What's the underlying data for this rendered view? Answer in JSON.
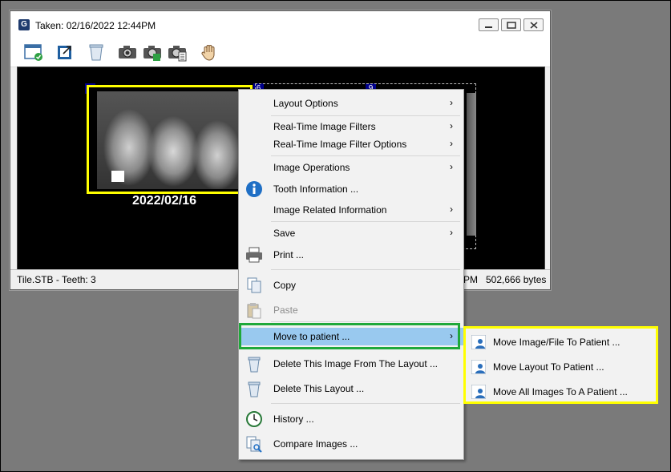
{
  "window": {
    "app_icon_letter": "G",
    "title": "Taken: 02/16/2022  12:44PM"
  },
  "toolbar": {
    "buttons": [
      "window-check-icon",
      "export-icon",
      "trash-icon",
      "camera-icon",
      "camera-green-icon",
      "camera-list-icon",
      "hand-icon"
    ]
  },
  "viewer": {
    "tiles": [
      {
        "number": "3",
        "date": "2022/02/16",
        "selected": true
      },
      {
        "number": "6"
      },
      {
        "number": "9"
      }
    ]
  },
  "status": {
    "left": "Tile.STB  - Teeth: 3",
    "time_fragment": "PM",
    "bytes": "502,666 bytes"
  },
  "menu": {
    "items": [
      {
        "label": "Layout Options",
        "submenu": true
      },
      {
        "label": "Real-Time Image Filters",
        "submenu": true
      },
      {
        "label": "Real-Time Image Filter Options",
        "submenu": true
      },
      {
        "label": "Image Operations",
        "submenu": true
      },
      {
        "label": "Tooth Information ...",
        "icon": "info-icon"
      },
      {
        "label": "Image Related Information",
        "submenu": true
      },
      {
        "label": "Save",
        "submenu": true
      },
      {
        "label": "Print ...",
        "icon": "printer-icon"
      },
      {
        "label": "Copy",
        "icon": "copy-icon"
      },
      {
        "label": "Paste",
        "icon": "paste-icon",
        "disabled": true
      },
      {
        "label": "Move to patient ...",
        "submenu": true,
        "highlighted": true
      },
      {
        "label": "Delete This Image From The Layout ...",
        "icon": "trash-icon"
      },
      {
        "label": "Delete This Layout ...",
        "icon": "trash-icon"
      },
      {
        "label": "History ...",
        "icon": "history-icon"
      },
      {
        "label": "Compare Images ...",
        "icon": "compare-icon"
      }
    ],
    "arrow": "›"
  },
  "submenu": {
    "items": [
      {
        "label": "Move Image/File To Patient ...",
        "icon": "person-icon"
      },
      {
        "label": "Move Layout To Patient ...",
        "icon": "person-icon"
      },
      {
        "label": "Move All Images To A Patient ...",
        "icon": "person-icon"
      }
    ]
  },
  "colors": {
    "highlight": "#99c9ef",
    "green_outline": "#1fa83a",
    "yellow_outline": "#ffff00",
    "tile_number_bg": "#00008b"
  }
}
